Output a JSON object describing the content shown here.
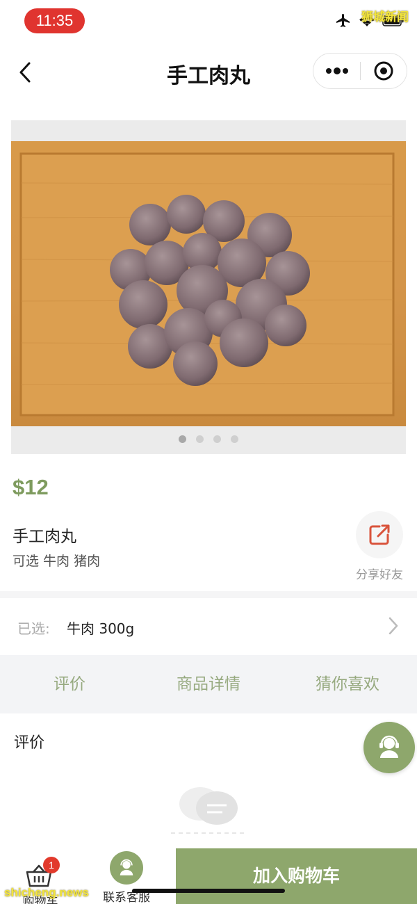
{
  "status_bar": {
    "time": "11:35",
    "watermark": "狮城新闻"
  },
  "nav": {
    "title": "手工肉丸"
  },
  "product": {
    "image_dots": 4,
    "active_dot": 0,
    "price": "$12",
    "name": "手工肉丸",
    "options": "可选 牛肉 猪肉",
    "share_label": "分享好友"
  },
  "selection": {
    "label": "已选:",
    "value": "牛肉 300g"
  },
  "tabs": [
    {
      "label": "评价"
    },
    {
      "label": "商品详情"
    },
    {
      "label": "猜你喜欢"
    }
  ],
  "review": {
    "title": "评价"
  },
  "bottom": {
    "cart_label": "购物车",
    "cart_count": "1",
    "service_label": "联系客服",
    "add_to_cart": "加入购物车"
  },
  "watermark_bottom": "shicheng.news",
  "colors": {
    "accent": "#8ea76c",
    "price": "#7e9b5e",
    "badge": "#e23a2c",
    "time_pill": "#e0342f"
  }
}
